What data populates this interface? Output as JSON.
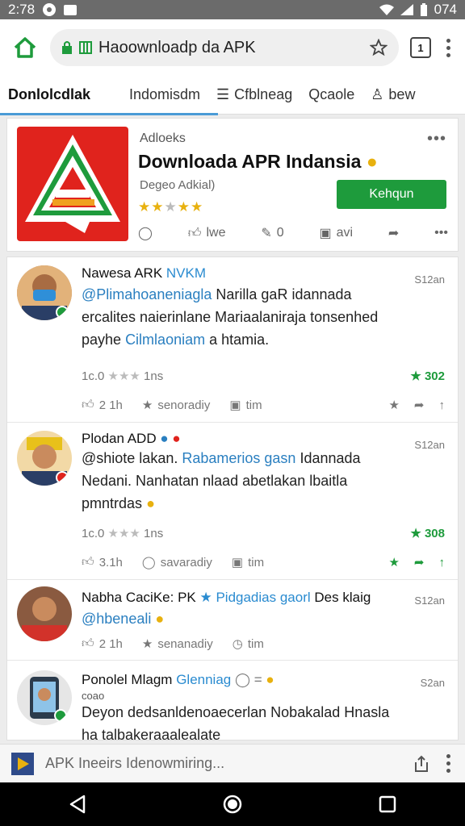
{
  "status": {
    "time": "2:78",
    "battery": "074"
  },
  "browser": {
    "url": "Haoownloadp da APK",
    "tab_count": "1"
  },
  "nav": {
    "tabs": [
      {
        "label": "Donlolcdlak"
      },
      {
        "label": "Indomisdm"
      },
      {
        "label": "Cfblneag"
      },
      {
        "label": "Qcaole"
      },
      {
        "label": "bew"
      }
    ]
  },
  "app": {
    "publisher": "Adloeks",
    "title": "Downloada APR Indansia",
    "subtitle": "Degeo Adkial)",
    "rating": 3,
    "install_label": "Kehqun",
    "actions": [
      {
        "label": ""
      },
      {
        "label": "lwe"
      },
      {
        "label": "0"
      },
      {
        "label": "avi"
      }
    ]
  },
  "posts": [
    {
      "name": "Nawesa ARK",
      "tag": "NVKM",
      "time": "S12an",
      "handle": "@Plimahoaneniagla",
      "line1_rest": "Narilla gaR idannada",
      "line2": "ercalites naierinlane  Mariaalaniraja tonsenhed",
      "line3_a": "payhe",
      "line3_handle": "Cilmlaoniam",
      "line3_b": "a htamia.",
      "meta_left": "1c.0",
      "meta_mid": "1ns",
      "meta_right": "302",
      "act_like": "2 1h",
      "act_share": "senoradiy",
      "act_box": "tim"
    },
    {
      "name": "Plodan ADD",
      "time": "S12an",
      "handle": "@shiote lakan.",
      "line1_tag": "Rabamerios gasn",
      "line1_rest": "Idannada",
      "line2": "Nedani.  Nanhatan nlaad abetlakan lbaitla",
      "line3_a": "pmntrdas",
      "meta_left": "1c.0",
      "meta_mid": "1ns",
      "meta_right": "308",
      "act_like": "3.1h",
      "act_share": "savaradiy",
      "act_box": "tim"
    },
    {
      "name": "Nabha CaciKe: PK",
      "tag": "Pidgadias gaorl",
      "name_rest": "Des klaig",
      "time": "S12an",
      "handle": "@hbeneali",
      "act_like": "2 1h",
      "act_share": "senanadiy",
      "act_box": "tim"
    },
    {
      "name": "Ponolel Mlagm",
      "tag": "Glenniag",
      "sub": "coao",
      "time": "S2an",
      "line2": "Deyon dedsanldenoaecerlan Nobakalad  Hnasla",
      "line3_a": "ha talbakeraaalealate"
    }
  ],
  "bottom": {
    "text": "APK Ineeirs  Idenowmiring..."
  },
  "colors": {
    "accent_green": "#1e9b3c",
    "link_blue": "#2a7fc0",
    "app_red": "#e0231d",
    "star": "#e8b10f"
  }
}
